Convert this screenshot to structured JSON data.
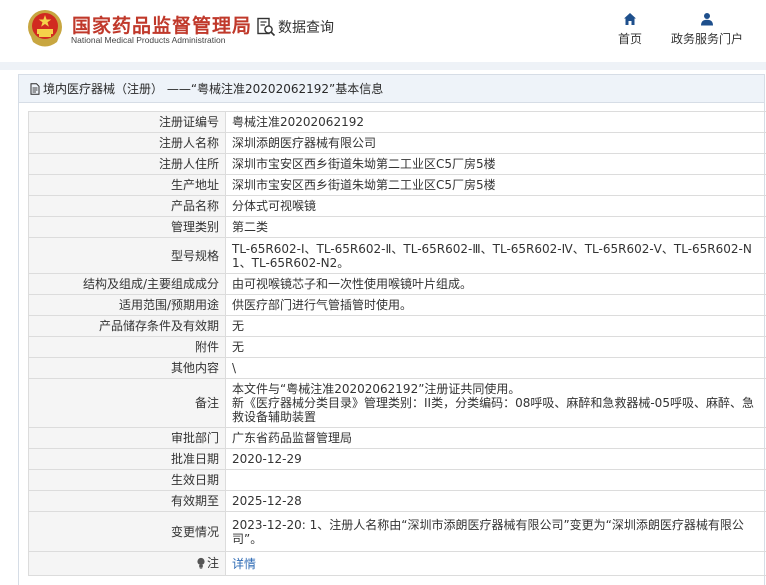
{
  "header": {
    "brand_cn": "国家药品监督管理局",
    "brand_en": "National Medical Products Administration",
    "data_query": "数据查询",
    "nav": [
      {
        "label": "首页",
        "icon": "home-icon"
      },
      {
        "label": "政务服务门户",
        "icon": "user-icon"
      }
    ],
    "brand_color": "#c0392b",
    "accent_color": "#1e4f8c"
  },
  "panel": {
    "title": "境内医疗器械（注册） ——“粤械注准20202062192”基本信息"
  },
  "rows": [
    {
      "label": "注册证编号",
      "value": "粤械注准20202062192"
    },
    {
      "label": "注册人名称",
      "value": "深圳添朗医疗器械有限公司"
    },
    {
      "label": "注册人住所",
      "value": "深圳市宝安区西乡街道朱坳第二工业区C5厂房5楼"
    },
    {
      "label": "生产地址",
      "value": "深圳市宝安区西乡街道朱坳第二工业区C5厂房5楼"
    },
    {
      "label": "产品名称",
      "value": "分体式可视喉镜"
    },
    {
      "label": "管理类别",
      "value": "第二类"
    },
    {
      "label": "型号规格",
      "value": "TL-65R602-Ⅰ、TL-65R602-Ⅱ、TL-65R602-Ⅲ、TL-65R602-Ⅳ、TL-65R602-Ⅴ、TL-65R602-N1、TL-65R602-N2。"
    },
    {
      "label": "结构及组成/主要组成成分",
      "value": "由可视喉镜芯子和一次性使用喉镜叶片组成。"
    },
    {
      "label": "适用范围/预期用途",
      "value": "供医疗部门进行气管插管时使用。"
    },
    {
      "label": "产品储存条件及有效期",
      "value": "无"
    },
    {
      "label": "附件",
      "value": "无"
    },
    {
      "label": "其他内容",
      "value": "\\"
    },
    {
      "label": "备注",
      "value_lines": [
        "本文件与“粤械注准20202062192”注册证共同使用。",
        "新《医疗器械分类目录》管理类别：II类，分类编码：08呼吸、麻醉和急救器械-05呼吸、麻醉、急救设备辅助装置"
      ]
    },
    {
      "label": "审批部门",
      "value": "广东省药品监督管理局"
    },
    {
      "label": "批准日期",
      "value": "2020-12-29"
    },
    {
      "label": "生效日期",
      "value": ""
    },
    {
      "label": "有效期至",
      "value": "2025-12-28"
    },
    {
      "label": "变更情况",
      "value": "2023-12-20: 1、注册人名称由“深圳市添朗医疗器械有限公司”变更为“深圳添朗医疗器械有限公司”。"
    },
    {
      "label": "注",
      "value": "详情",
      "icon": "bulb-icon"
    }
  ]
}
